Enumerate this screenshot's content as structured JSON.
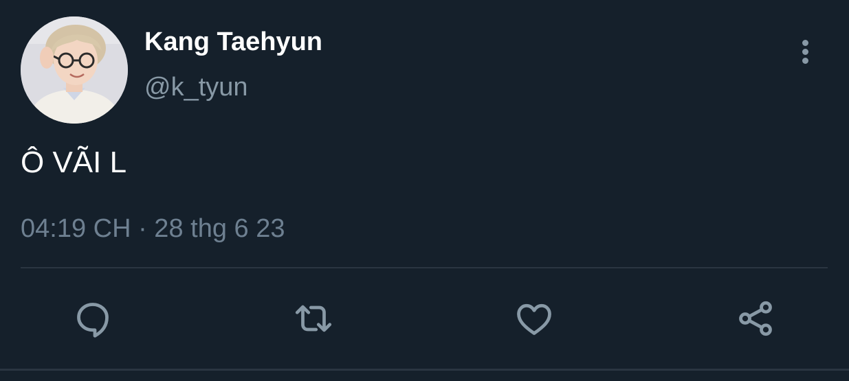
{
  "tweet": {
    "display_name": "Kang Taehyun",
    "handle": "@k_tyun",
    "text": "Ô VÃI L",
    "timestamp": "04:19 CH · 28 thg 6 23"
  },
  "icons": {
    "avatar": "profile-photo",
    "more": "more-vertical-icon",
    "reply": "reply-icon",
    "retweet": "retweet-icon",
    "like": "heart-icon",
    "share": "share-icon"
  },
  "colors": {
    "background": "#15202b",
    "primary_text": "#ffffff",
    "secondary_text": "#8899a6",
    "divider": "#2a3541"
  }
}
